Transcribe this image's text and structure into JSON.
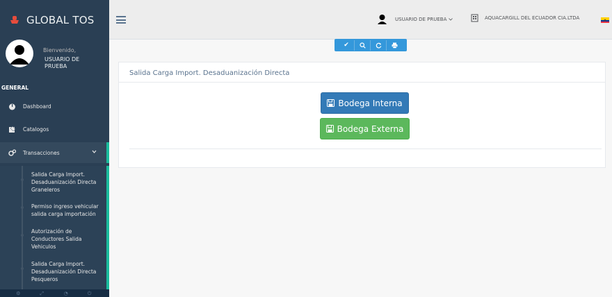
{
  "brand": {
    "title": "GLOBAL TOS"
  },
  "profile": {
    "welcome": "Bienvenido,",
    "name": "USUARIO DE PRUEBA"
  },
  "sidebar": {
    "section": "GENERAL",
    "items": [
      {
        "label": "Dashboard",
        "icon": "dashboard-icon"
      },
      {
        "label": "Catalogos",
        "icon": "edit-icon"
      },
      {
        "label": "Transacciones",
        "icon": "gears-icon"
      }
    ],
    "submenu": [
      "Salida Carga Import. Desaduanización Directa Graneleros",
      "Permiso ingreso vehicular salida carga importación",
      "Autorización de Conductores Salida Vehiculos",
      "Salida Carga Import. Desaduanización Directa Pesqueros"
    ]
  },
  "topnav": {
    "user": "USUARIO DE PRUEBA",
    "company": "AQUACARGILL DEL ECUADOR CIA.LTDA"
  },
  "panel": {
    "title": "Salida Carga Import. Desaduanización Directa",
    "btn_interna": "Bodega Interna",
    "btn_externa": "Bodega Externa"
  },
  "colors": {
    "sidebar": "#2a3f54",
    "accent": "#1ABB9C",
    "primary": "#337ab7",
    "success": "#5cb85c"
  }
}
